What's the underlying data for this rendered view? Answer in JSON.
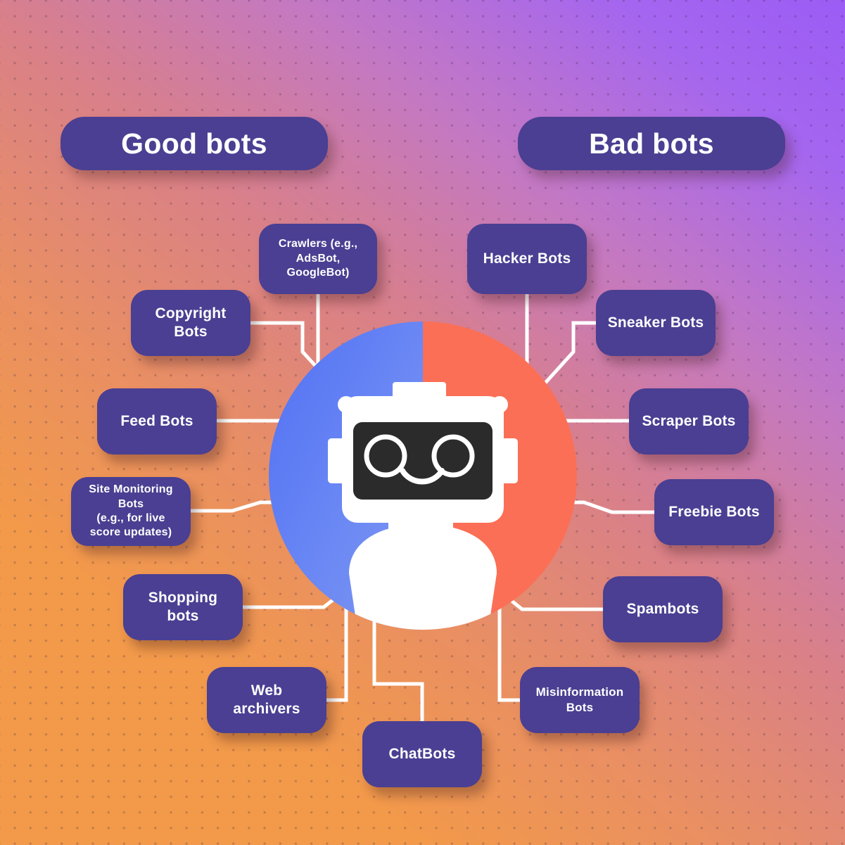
{
  "headers": {
    "good": "Good bots",
    "bad": "Bad bots"
  },
  "center": {
    "icon": "robot-mascot",
    "left_color": "#6684f4",
    "right_color": "#fb6f56"
  },
  "colors": {
    "node_fill": "#4a3f92",
    "connector": "#ffffff",
    "bg_from": "#f2994a",
    "bg_to": "#9b5cf5",
    "robot_face": "#2b2b2b"
  },
  "good_bots": [
    {
      "label": "Crawlers (e.g., AdsBot, GoogleBot)"
    },
    {
      "label": "Copyright Bots"
    },
    {
      "label": "Feed Bots"
    },
    {
      "label": "Site Monitoring Bots (e.g., for live score updates)"
    },
    {
      "label": "Shopping bots"
    },
    {
      "label": "Web archivers"
    },
    {
      "label": "ChatBots"
    }
  ],
  "bad_bots": [
    {
      "label": "Hacker Bots"
    },
    {
      "label": "Sneaker Bots"
    },
    {
      "label": "Scraper Bots"
    },
    {
      "label": "Freebie Bots"
    },
    {
      "label": "Spambots"
    },
    {
      "label": "Misinformation Bots"
    }
  ],
  "nodes": {
    "crawlers_l1": "Crawlers (e.g.,",
    "crawlers_l2": "AdsBot, GoogleBot)",
    "copyright": "Copyright Bots",
    "feed": "Feed Bots",
    "monitoring_l1": "Site Monitoring Bots",
    "monitoring_l2": "(e.g., for live",
    "monitoring_l3": "score updates)",
    "shopping": "Shopping bots",
    "archivers": "Web archivers",
    "chatbots": "ChatBots",
    "hacker": "Hacker Bots",
    "sneaker": "Sneaker Bots",
    "scraper": "Scraper Bots",
    "freebie": "Freebie Bots",
    "spambots": "Spambots",
    "misinfo_l1": "Misinformation",
    "misinfo_l2": "Bots"
  }
}
